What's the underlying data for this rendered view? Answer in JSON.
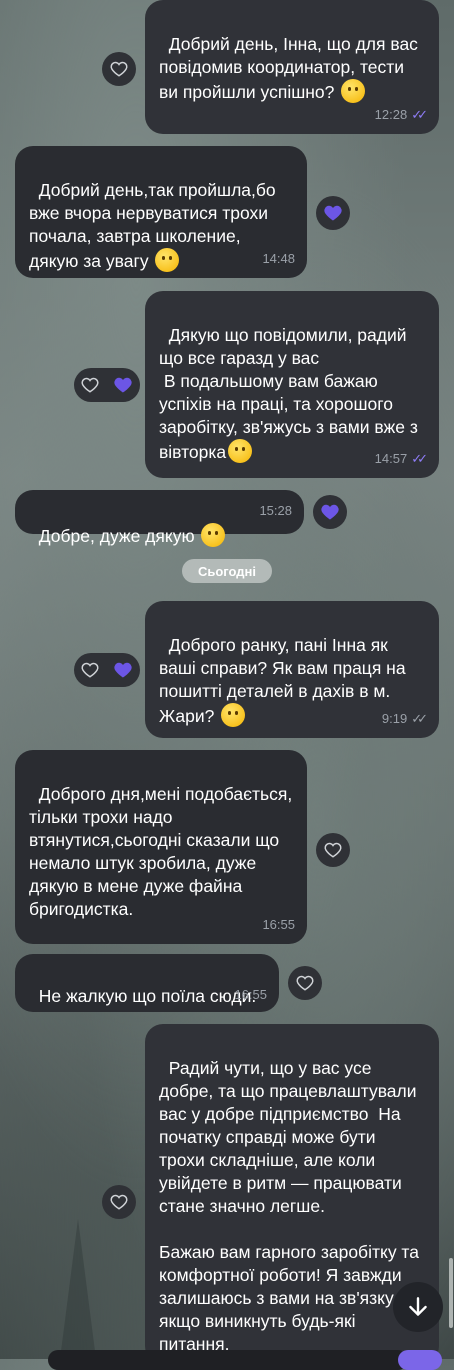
{
  "colors": {
    "accent": "#8e7cf6",
    "bubble": "#2a2c31",
    "heart": "#6c56e6"
  },
  "messages": [
    {
      "id": "m1",
      "text": "Добрий день, Інна, що для вас повідомив координатор, тести ви пройшли успішно? ",
      "time": "12:28",
      "status": "read"
    },
    {
      "id": "m2",
      "text": "Добрий день,так пройшла,бо вже вчора нервуватися трохи почала, завтра школение, дякую за увагу ",
      "time": "14:48"
    },
    {
      "id": "m3",
      "text": "Дякую що повідомили, радий що все гаразд у вас\n В подальшому вам бажаю успіхів на праці, та хорошого заробітку, зв'яжусь з вами вже з вівторка",
      "time": "14:57",
      "status": "read"
    },
    {
      "id": "m4",
      "text": "Добре, дуже дякую ",
      "time": "15:28"
    },
    {
      "id": "m5",
      "text": "Доброго ранку, пані Інна як ваші справи? Як вам праця на пошитті деталей в дахів в м. Жари? ",
      "time": "9:19",
      "status": "delivered"
    },
    {
      "id": "m6",
      "text": "Доброго дня,мені подобається, тільки трохи надо втянутися,сьогодні сказали що немало штук зробила, дуже дякую в мене дуже файна бригодистка.",
      "time": "16:55"
    },
    {
      "id": "m7",
      "text": "Не жалкую що поїла сюди.",
      "time": "16:55"
    },
    {
      "id": "m8",
      "text": "Радий чути, що у вас усе добре, та що працевлаштували вас у добре підприємство  На початку справді може бути трохи складніше, але коли увійдете в ритм — працювати стане значно легше.\n\nБажаю вам гарного заробітку та комфортної роботи! Я завжди залишаюсь з вами на зв'язку, якщо виникнуть будь-які питання."
    }
  ],
  "date_separator": "Сьогодні",
  "icons": {
    "heart_outline": "heart-outline-icon",
    "heart_filled": "heart-filled-icon",
    "scroll_down": "arrow-down-icon",
    "read_ticks": "double-check-icon"
  }
}
